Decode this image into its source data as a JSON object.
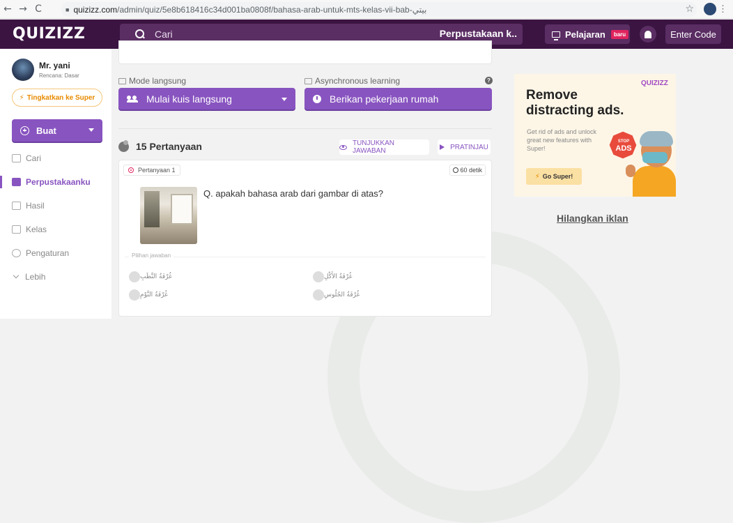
{
  "browser": {
    "back": "←",
    "forward": "→",
    "reload": "C",
    "url_domain": "quizizz.com",
    "url_path": "/admin/quiz/5e8b618416c34d001ba0808f/bahasa-arab-untuk-mts-kelas-vii-bab-بيتي",
    "star": "☆",
    "menu": "⋮"
  },
  "appbar": {
    "logo": "QUIZIZZ",
    "search_placeholder": "Cari",
    "search_scope": "Perpustakaan k..",
    "lesson_label": "Pelajaran",
    "lesson_badge": "baru",
    "enter_code": "Enter Code"
  },
  "sidebar": {
    "user_name": "Mr. yani",
    "user_plan": "Rencana: Dasar",
    "upgrade": "Tingkatkan ke Super",
    "create": "Buat",
    "items": [
      {
        "label": "Cari"
      },
      {
        "label": "Perpustakaanku"
      },
      {
        "label": "Hasil"
      },
      {
        "label": "Kelas"
      },
      {
        "label": "Pengaturan"
      },
      {
        "label": "Lebih"
      }
    ]
  },
  "main": {
    "live_mode_label": "Mode langsung",
    "async_label": "Asynchronous learning",
    "help": "?",
    "live_button": "Mulai kuis langsung",
    "homework_button": "Berikan pekerjaan rumah",
    "question_count": "15 Pertanyaan",
    "show_answers": "TUNJUKKAN JAWABAN",
    "preview": "PRATINJAU",
    "question": {
      "tag": "Pertanyaan 1",
      "timer": "60 detik",
      "text": "Q. apakah bahasa arab dari gambar di atas?",
      "answers_label": "Pilihan jawaban",
      "options": [
        "غُرْفَةُ النَّظَبِ",
        "غُرْفَةُ الأَكْلِ",
        "غُرْفَةُ النَّوْمِ",
        "غُرْفَةُ الجُلُوسِ"
      ]
    }
  },
  "ad": {
    "logo": "QUIZIZZ",
    "title": "Remove distracting ads.",
    "subtitle": "Get rid of ads and unlock great new features with Super!",
    "cta": "Go Super!",
    "stop_top": "STOP",
    "stop_bottom": "ADS",
    "hide": "Hilangkan iklan"
  },
  "colors": {
    "appbar_bg": "#3b1442",
    "accent_purple": "#8854c0",
    "upgrade_orange": "#e88a00"
  }
}
